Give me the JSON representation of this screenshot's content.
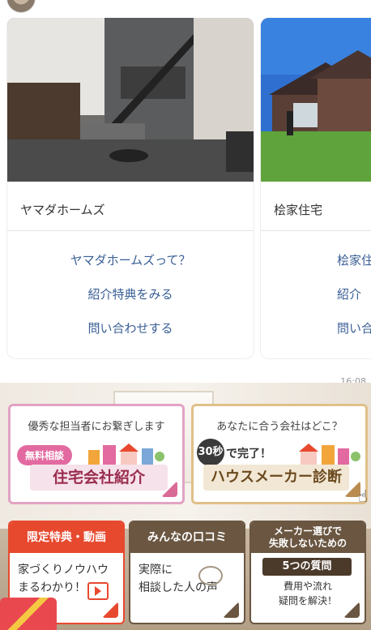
{
  "cards": [
    {
      "name": "ヤマダホームズ",
      "links": [
        "ヤマダホームズって？",
        "紹介特典をみる",
        "問い合わせする"
      ]
    },
    {
      "name": "桧家住宅",
      "links": [
        "桧家住",
        "紹介",
        "問い合"
      ]
    }
  ],
  "timestamp": "16:08",
  "banners": {
    "consult": {
      "headline": "優秀な担当者にお繋ぎします",
      "pill": "無料相談",
      "main": "住宅会社紹介"
    },
    "diagnosis": {
      "headline": "あなたに合う会社はどこ？",
      "badge": "30秒",
      "done": "で完了！",
      "main": "ハウスメーカー診断"
    },
    "limited": {
      "head": "限定特典・動画",
      "body_line1": "家づくりノウハウ",
      "body_line2": "まるわかり！"
    },
    "reviews": {
      "head": "みんなの口コミ",
      "body_line1": "実際に",
      "body_line2": "相談した人の声"
    },
    "questions": {
      "head_line1": "メーカー選びで",
      "head_line2": "失敗しないための",
      "pill": "5つの質問",
      "body_line1": "費用や流れ",
      "body_line2": "疑問を解決！"
    }
  }
}
